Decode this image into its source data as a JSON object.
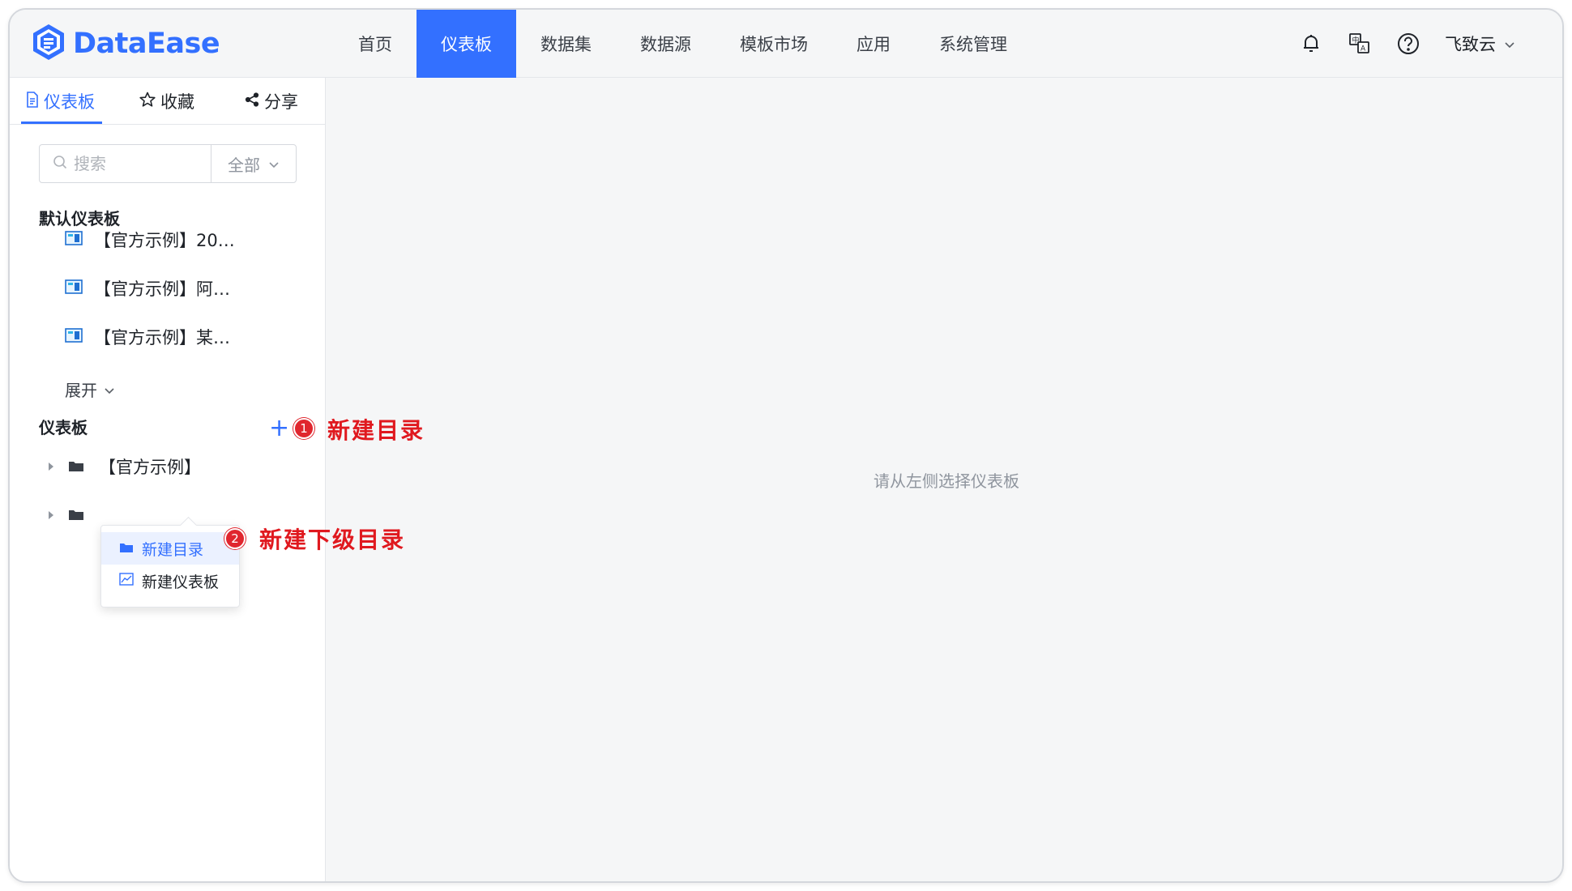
{
  "app": {
    "logo_text": "DataEase",
    "brand_color": "#3370ff"
  },
  "nav": {
    "items": [
      {
        "label": "首页",
        "active": false
      },
      {
        "label": "仪表板",
        "active": true
      },
      {
        "label": "数据集",
        "active": false
      },
      {
        "label": "数据源",
        "active": false
      },
      {
        "label": "模板市场",
        "active": false
      },
      {
        "label": "应用",
        "active": false
      },
      {
        "label": "系统管理",
        "active": false
      }
    ]
  },
  "header_tools": {
    "icons": [
      "bell-icon",
      "translate-icon",
      "help-icon"
    ],
    "user_name": "飞致云"
  },
  "sidebar": {
    "tabs": [
      {
        "label": "仪表板",
        "icon": "document-icon",
        "active": true
      },
      {
        "label": "收藏",
        "icon": "star-icon",
        "active": false
      },
      {
        "label": "分享",
        "icon": "share-icon",
        "active": false
      }
    ],
    "search": {
      "placeholder": "搜索",
      "filter_value": "全部"
    },
    "default_section": {
      "title": "默认仪表板",
      "items": [
        {
          "label": "【官方示例】20…"
        },
        {
          "label": "【官方示例】阿…"
        },
        {
          "label": "【官方示例】某…"
        }
      ],
      "expand_label": "展开"
    },
    "dashboard_section": {
      "title": "仪表板",
      "add_icon": "plus-icon",
      "tree": [
        {
          "label": "【官方示例】"
        },
        {
          "label": ""
        }
      ]
    },
    "context_menu": {
      "items": [
        {
          "label": "新建目录",
          "icon": "folder-icon",
          "hover": true
        },
        {
          "label": "新建仪表板",
          "icon": "chart-icon",
          "hover": false
        }
      ]
    }
  },
  "annotations": [
    {
      "number": "1",
      "text": "新建目录"
    },
    {
      "number": "2",
      "text": "新建下级目录"
    }
  ],
  "main": {
    "empty_text": "请从左侧选择仪表板"
  }
}
